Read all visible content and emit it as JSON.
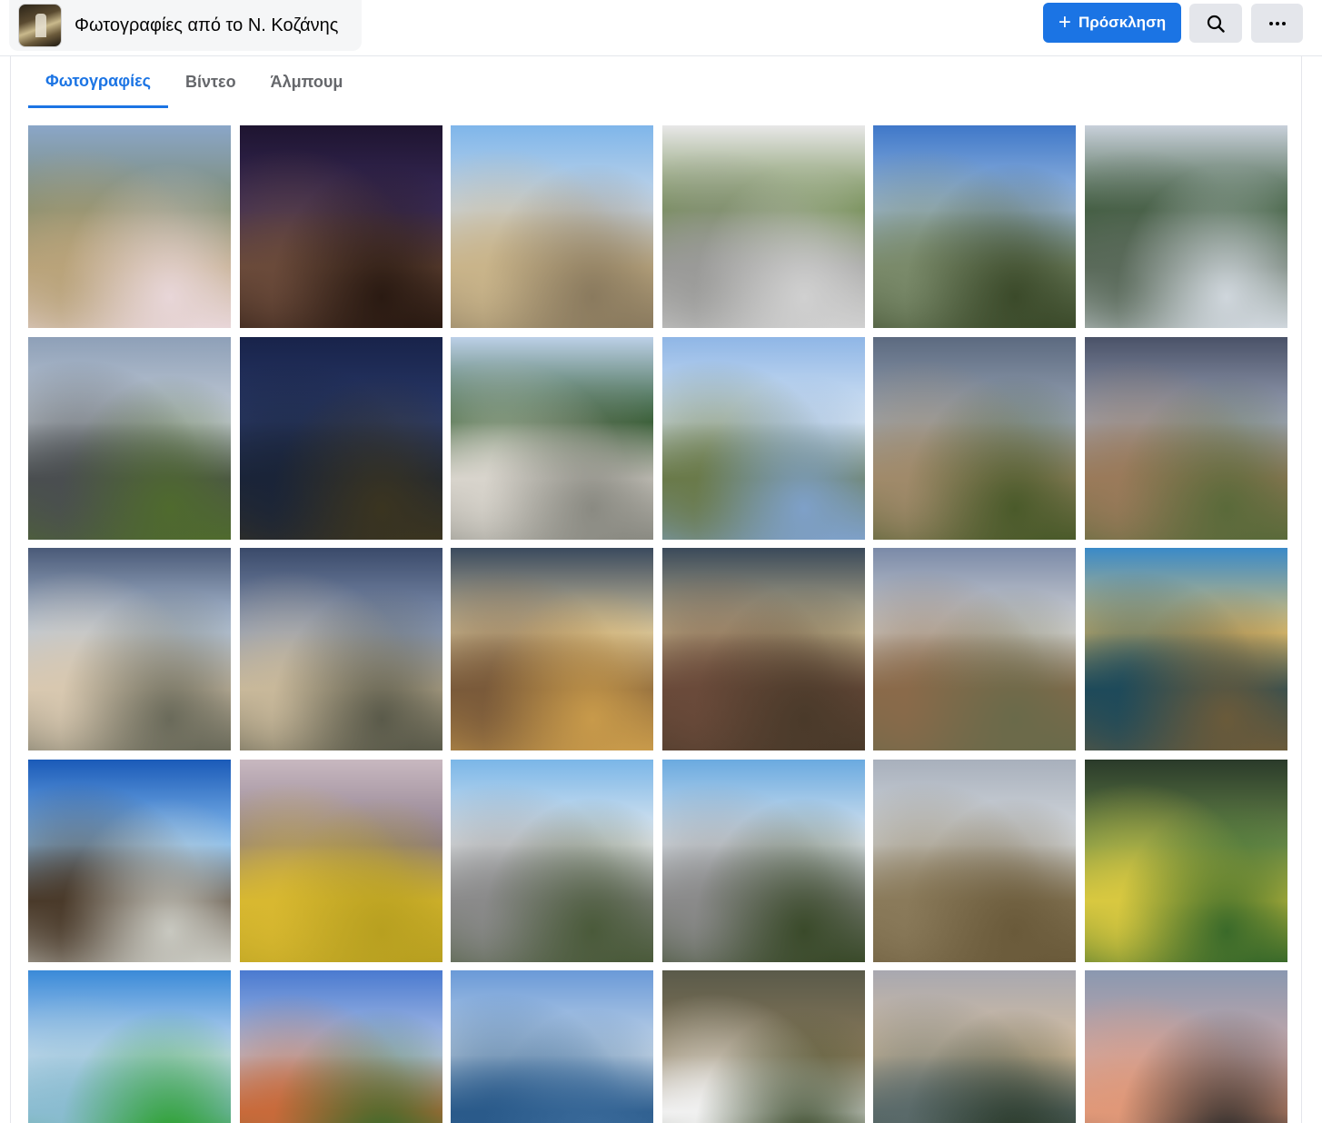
{
  "header": {
    "group_title": "Φωτογραφίες από το Ν. Κοζάνης",
    "invite_label": "Πρόσκληση",
    "search_icon": "search-icon",
    "more_icon": "more-horizontal-icon",
    "accent_color": "#1b74e4"
  },
  "tabs": [
    {
      "label": "Φωτογραφίες",
      "active": true
    },
    {
      "label": "Βίντεο",
      "active": false
    },
    {
      "label": "Άλμπουμ",
      "active": false
    }
  ],
  "photos": [
    {
      "name": "photo-mountain-almond-blossom",
      "colors": [
        "#8aa6c8",
        "#7d8a6e",
        "#b9a37a",
        "#e8d6d8"
      ]
    },
    {
      "name": "photo-night-moon-tree",
      "colors": [
        "#1e1430",
        "#3a2b5a",
        "#6a4a3a",
        "#2a1a12"
      ]
    },
    {
      "name": "photo-old-house-graffiti",
      "colors": [
        "#7fb6ea",
        "#c9d8e8",
        "#c9b48a",
        "#8a7a5e"
      ]
    },
    {
      "name": "photo-town-square",
      "colors": [
        "#e8e8e8",
        "#6f8a4e",
        "#9a9a98",
        "#d0d0d0"
      ]
    },
    {
      "name": "photo-blue-sky-valley",
      "colors": [
        "#3f78c9",
        "#9fbde0",
        "#7a8a6a",
        "#3b4a2a"
      ]
    },
    {
      "name": "photo-snow-fir-tree",
      "colors": [
        "#c8d0da",
        "#3b5a3a",
        "#5a6a5a",
        "#cfd6dc"
      ]
    },
    {
      "name": "photo-road-evening-sky",
      "colors": [
        "#8ea0b8",
        "#c4ccd6",
        "#4a4e50",
        "#4f6a2e"
      ]
    },
    {
      "name": "photo-night-city-lights",
      "colors": [
        "#18234a",
        "#2a3a6a",
        "#1a2438",
        "#3a3420"
      ]
    },
    {
      "name": "photo-blossom-tree-road",
      "colors": [
        "#bcd0e8",
        "#2f5a2e",
        "#d8d4cc",
        "#8a8a82"
      ]
    },
    {
      "name": "photo-lake-reflection",
      "colors": [
        "#8fb6e6",
        "#d8e6f4",
        "#6a7a4a",
        "#7ea0c8"
      ]
    },
    {
      "name": "photo-cloudy-town-cypress",
      "colors": [
        "#5c6a80",
        "#9aa6b6",
        "#a08a6a",
        "#4a5a2a"
      ]
    },
    {
      "name": "photo-church-cypress-town",
      "colors": [
        "#4a5268",
        "#9ea6ba",
        "#9a7a5a",
        "#5a6a3a"
      ]
    },
    {
      "name": "photo-houses-poplar",
      "colors": [
        "#4a5a78",
        "#b8c8dc",
        "#d8c8b0",
        "#6a6a5a"
      ]
    },
    {
      "name": "photo-storm-poplar-houses",
      "colors": [
        "#3a4a6a",
        "#8a9ab8",
        "#c8b89a",
        "#5a5a4a"
      ]
    },
    {
      "name": "photo-sunset-balcony",
      "colors": [
        "#3a4a5e",
        "#d8c8a0",
        "#7a5a3a",
        "#c89a4a"
      ]
    },
    {
      "name": "photo-sunset-apartments",
      "colors": [
        "#3a4a5a",
        "#c8b890",
        "#6a4a3a",
        "#4a3a2a"
      ]
    },
    {
      "name": "photo-hill-village",
      "colors": [
        "#7a8aa8",
        "#d8d8d8",
        "#8a6a4a",
        "#6a6a4a"
      ]
    },
    {
      "name": "photo-vintage-train-platform",
      "colors": [
        "#3a8ac8",
        "#e0c070",
        "#1e4a5a",
        "#6a5a3a"
      ]
    },
    {
      "name": "photo-bare-tree-blue-sky",
      "colors": [
        "#1a5ab8",
        "#8ac0f0",
        "#4a3a2a",
        "#c8c8c0"
      ]
    },
    {
      "name": "photo-rapeseed-lake",
      "colors": [
        "#c8b8c0",
        "#8a7a8a",
        "#d8b830",
        "#b8a020"
      ]
    },
    {
      "name": "photo-bell-tower-road",
      "colors": [
        "#7ab6e8",
        "#e8ecf0",
        "#8a8a8a",
        "#4a5a3a"
      ]
    },
    {
      "name": "photo-bell-tower-road-2",
      "colors": [
        "#6aaae0",
        "#e0e8f0",
        "#8a8a8a",
        "#3a4a2a"
      ]
    },
    {
      "name": "photo-castle-ruins-hill",
      "colors": [
        "#a8b0bc",
        "#d8dce0",
        "#8a7a5a",
        "#6a5a3a"
      ]
    },
    {
      "name": "photo-park-sunny-meadow",
      "colors": [
        "#2a3a2a",
        "#6a8a4a",
        "#d8c840",
        "#3a6a2a"
      ]
    },
    {
      "name": "photo-green-field-lake",
      "colors": [
        "#3a8ad8",
        "#c8dcf0",
        "#8abcd0",
        "#2aa02a"
      ]
    },
    {
      "name": "photo-chapel-pine",
      "colors": [
        "#4a7ad0",
        "#b8c8e8",
        "#c86a3a",
        "#3a6a2a"
      ]
    },
    {
      "name": "photo-lake-bridge",
      "colors": [
        "#6a9ad8",
        "#c8d8e8",
        "#2a5a8a",
        "#3a6a9a"
      ]
    },
    {
      "name": "photo-white-blossoms",
      "colors": [
        "#5a5a4a",
        "#8a7a5a",
        "#f0f0f0",
        "#3a4a2a"
      ]
    },
    {
      "name": "photo-mountains-cypress-dusk",
      "colors": [
        "#a8a8b0",
        "#d8c0a0",
        "#5a6a6a",
        "#2a3a2a"
      ]
    },
    {
      "name": "photo-sunset-gradient",
      "colors": [
        "#8a98b0",
        "#c8a8a8",
        "#e09878",
        "#2a2a2a"
      ]
    }
  ]
}
